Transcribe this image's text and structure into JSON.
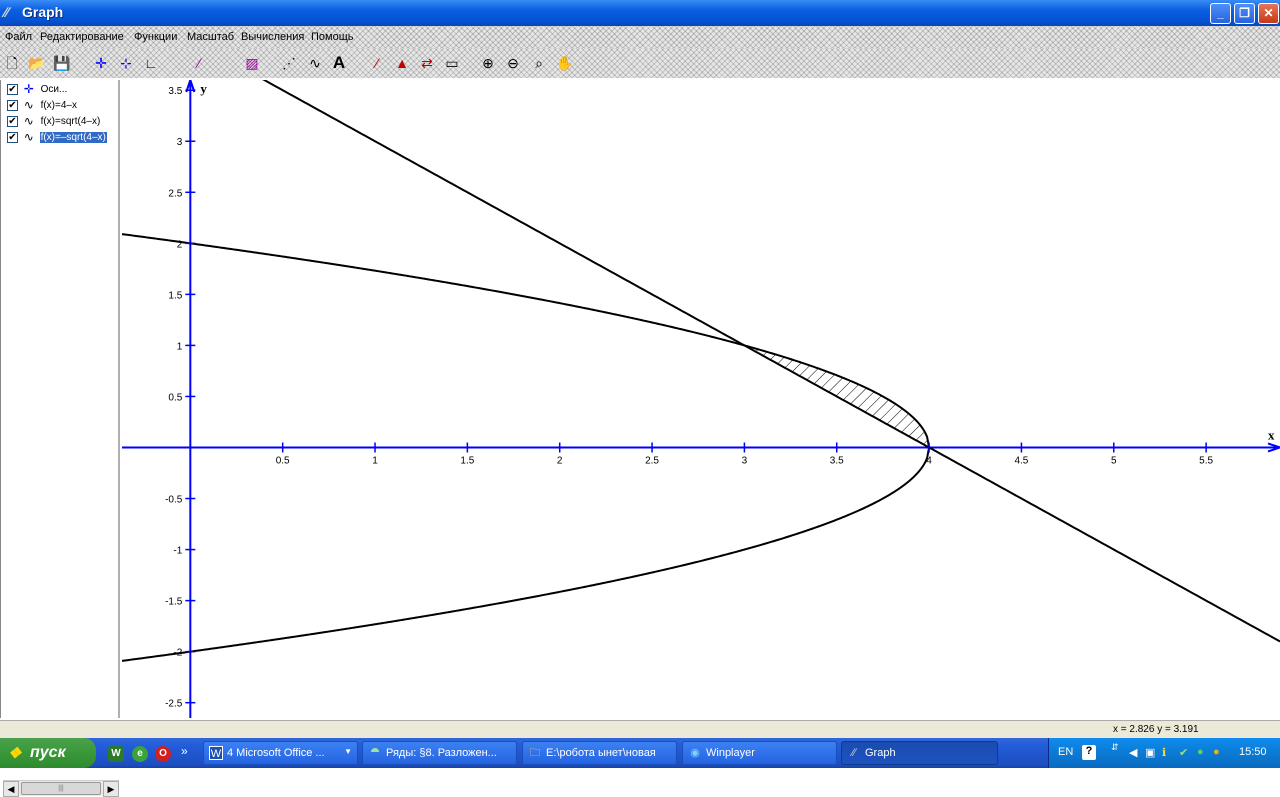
{
  "window": {
    "title": "Graph",
    "buttons": {
      "minimize": "_",
      "restore": "❐",
      "close": "✕"
    }
  },
  "menu": [
    "Файл",
    "Редактирование",
    "Функции",
    "Масштаб",
    "Вычисления",
    "Помощь"
  ],
  "toolbar": [
    "new-icon",
    "open-icon",
    "save-icon",
    "axes-icon",
    "insert-function-icon",
    "insert-tangent-icon",
    "insert-relation-icon",
    "insert-shading-icon",
    "insert-point-series-icon",
    "insert-trendline-icon",
    "insert-label-icon",
    "evaluate-icon",
    "area-icon",
    "table-icon",
    "zoom-in-icon",
    "zoom-out-icon",
    "zoom-square-icon",
    "move-hand-icon"
  ],
  "functions_panel": {
    "items": [
      {
        "label": "Оси...",
        "checked": true,
        "icon": "axes-icon",
        "selected": false
      },
      {
        "label": "f(x)=4–x",
        "checked": true,
        "icon": "function-curve-icon",
        "selected": false
      },
      {
        "label": "f(x)=sqrt(4–x)",
        "checked": true,
        "icon": "function-curve-icon",
        "selected": false
      },
      {
        "label": "f(x)=–sqrt(4–x)",
        "checked": true,
        "icon": "function-curve-icon",
        "selected": true
      }
    ]
  },
  "chart_data": {
    "type": "line",
    "xlabel": "x",
    "ylabel": "y",
    "xlim": [
      -0.37,
      5.9
    ],
    "ylim": [
      -2.65,
      3.6
    ],
    "x_ticks": [
      "0.5",
      "1",
      "1.5",
      "2",
      "2.5",
      "3",
      "3.5",
      "4",
      "4.5",
      "5",
      "5.5"
    ],
    "x_tick_values": [
      0.5,
      1,
      1.5,
      2,
      2.5,
      3,
      3.5,
      4,
      4.5,
      5,
      5.5
    ],
    "y_ticks": [
      "3.5",
      "3",
      "2.5",
      "2",
      "1.5",
      "1",
      "0.5",
      "-0.5",
      "-1",
      "-1.5",
      "-2",
      "-2.5"
    ],
    "y_tick_values": [
      3.5,
      3,
      2.5,
      2,
      1.5,
      1,
      0.5,
      -0.5,
      -1,
      -1.5,
      -2,
      -2.5
    ],
    "axis_color": "#0000ff",
    "curve_color": "#000000",
    "series": [
      {
        "expr": "4-x",
        "kind": "function",
        "x_range": [
          -0.37,
          5.9
        ]
      },
      {
        "expr": "sqrt(4-x)",
        "kind": "function",
        "x_range": [
          -0.37,
          4
        ]
      },
      {
        "expr": "-sqrt(4-x)",
        "kind": "function",
        "x_range": [
          -0.37,
          4
        ]
      }
    ],
    "shading": {
      "between": [
        "4-x",
        "sqrt(4-x)"
      ],
      "from": 3,
      "to": 4,
      "pattern": "hatch"
    }
  },
  "status": {
    "coords": "x = 2.826    y = 3.191"
  },
  "taskbar": {
    "start": "пуск",
    "quick_launch": [
      "word-icon",
      "browser-icon",
      "opera-icon"
    ],
    "more": "»",
    "tasks": [
      {
        "label": "4 Microsoft Office ...",
        "icon": "word-icon",
        "active": false,
        "dropdown": true
      },
      {
        "label": "Ряды: §8. Разложен...",
        "icon": "document-icon",
        "active": false,
        "dropdown": false
      },
      {
        "label": "E:\\робота ынет\\новая",
        "icon": "folder-icon",
        "active": false,
        "dropdown": false
      },
      {
        "label": "Winplayer",
        "icon": "player-icon",
        "active": false,
        "dropdown": false
      },
      {
        "label": "Graph",
        "icon": "graph-app-icon",
        "active": true,
        "dropdown": false
      }
    ],
    "tray": {
      "lang": "EN",
      "help": "?",
      "clock": "15:50"
    }
  }
}
